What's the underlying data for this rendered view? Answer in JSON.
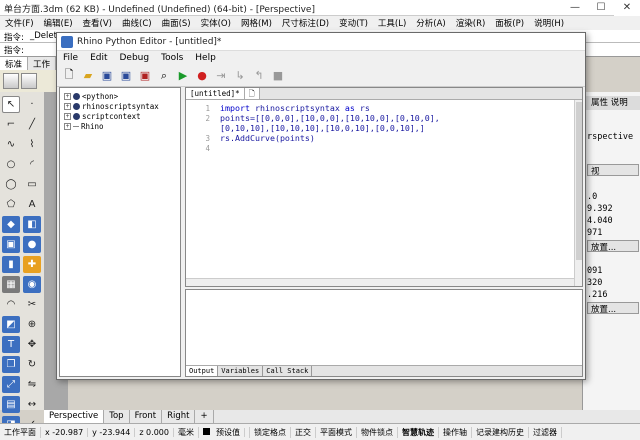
{
  "app": {
    "title": "单台方面.3dm (62 KB) - Undefined (Undefined) (64-bit) - [Perspective]",
    "window_controls": [
      "—",
      "☐",
      "✕"
    ]
  },
  "menu": [
    "文件(F)",
    "编辑(E)",
    "查看(V)",
    "曲线(C)",
    "曲面(S)",
    "实体(O)",
    "网格(M)",
    "尺寸标注(D)",
    "变动(T)",
    "工具(L)",
    "分析(A)",
    "渲染(R)",
    "面板(P)",
    "说明(H)"
  ],
  "command_history": {
    "label": "指令:",
    "value": "_Delet"
  },
  "command_prompt": {
    "label": "指令:"
  },
  "toolbar_tabs": [
    "标准",
    "工作"
  ],
  "editor": {
    "title": "Rhino Python Editor - [untitled]*",
    "menu": [
      "File",
      "Edit",
      "Debug",
      "Tools",
      "Help"
    ],
    "tree": [
      "<python>",
      "rhinoscriptsyntax",
      "scriptcontext",
      "Rhino"
    ],
    "tabs": [
      "[untitled]*",
      ""
    ],
    "code": {
      "line_numbers": [
        "1",
        "2",
        "3",
        "4"
      ],
      "line1": {
        "kw1": "import",
        "mid": " rhinoscriptsyntax ",
        "kw2": "as",
        "tail": " rs"
      },
      "line2": "points=[[0,0,0],[10,0,0],[10,10,0],[0,10,0],",
      "line3": "[0,10,10],[10,10,10],[10,0,10],[0,0,10],]",
      "line4": "rs.AddCurve(points)"
    },
    "output_tabs": [
      "Output",
      "Variables",
      "Call Stack"
    ]
  },
  "right_panel": {
    "tab": "属性 说明",
    "view_label": "rspective",
    "dropdown": "视",
    "values": [
      ".0",
      "9.392",
      "4.040",
      "971"
    ],
    "button1": "放置...",
    "values2": [
      "091",
      "320",
      ".216"
    ],
    "button2": "放置..."
  },
  "viewport_tabs": [
    "Perspective",
    "Top",
    "Front",
    "Right",
    "+"
  ],
  "status": {
    "plane": "工作平面",
    "x": "x -20.987",
    "y": "y -23.944",
    "z": "z 0.000",
    "unit": "毫米",
    "layer": "预设值",
    "toggles": [
      "锁定格点",
      "正交",
      "平面模式",
      "物件锁点",
      "智慧轨迹",
      "操作轴",
      "记录建构历史",
      "过滤器"
    ]
  }
}
